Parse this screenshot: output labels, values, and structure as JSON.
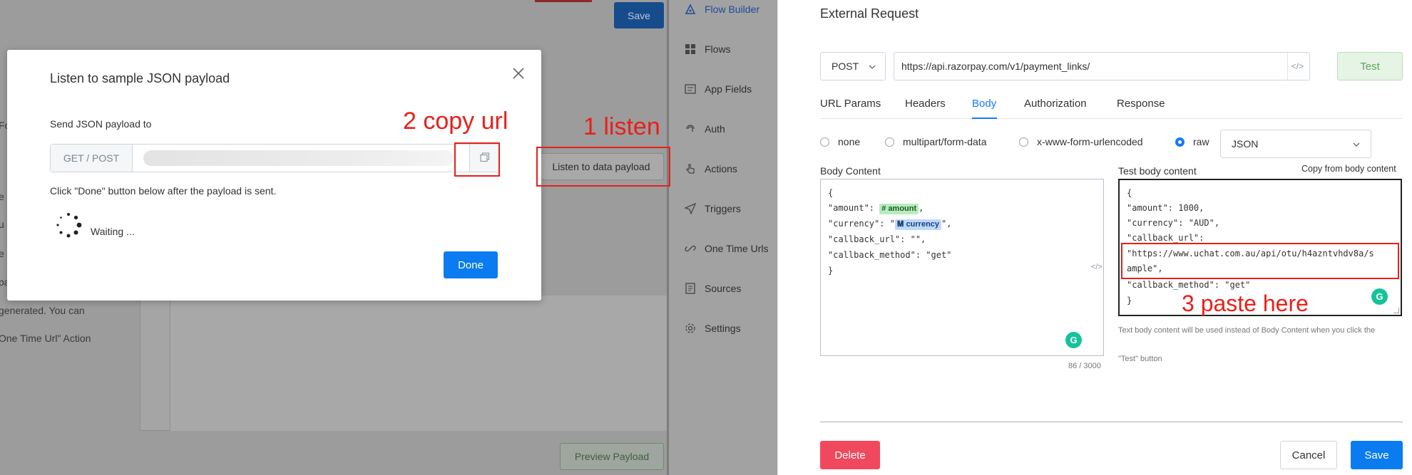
{
  "background": {
    "side_fragments": [
      "Fo",
      "e",
      "u",
      "e",
      "pa",
      "generated. You can",
      "One Time Url\" Action"
    ],
    "save_label": "Save",
    "listen_button_label": "Listen to data payload",
    "preview_button_label": "Preview Payload"
  },
  "sidebar": {
    "items": [
      {
        "label": "Flow Builder",
        "icon": "flow-builder-icon",
        "active": true
      },
      {
        "label": "Flows",
        "icon": "grid-icon"
      },
      {
        "label": "App Fields",
        "icon": "app-fields-icon"
      },
      {
        "label": "Auth",
        "icon": "auth-icon"
      },
      {
        "label": "Actions",
        "icon": "hand-pointer-icon"
      },
      {
        "label": "Triggers",
        "icon": "send-icon"
      },
      {
        "label": "One Time Urls",
        "icon": "link-icon"
      },
      {
        "label": "Sources",
        "icon": "document-icon"
      },
      {
        "label": "Settings",
        "icon": "gear-icon"
      }
    ]
  },
  "modal": {
    "title": "Listen to sample JSON payload",
    "send_label": "Send JSON payload to",
    "method_addon": "GET / POST",
    "hint": "Click \"Done\" button below after the payload is sent.",
    "waiting": "Waiting ...",
    "done_label": "Done"
  },
  "annotations": {
    "step1": "1 listen",
    "step2": "2 copy url",
    "step3": "3 paste here",
    "color": "#e8201a"
  },
  "request": {
    "title": "External Request",
    "method": "POST",
    "url": "https://api.razorpay.com/v1/payment_links/",
    "test_label": "Test",
    "tabs": [
      {
        "label": "URL Params"
      },
      {
        "label": "Headers"
      },
      {
        "label": "Body",
        "active": true
      },
      {
        "label": "Authorization"
      },
      {
        "label": "Response"
      }
    ],
    "body_types": [
      {
        "label": "none"
      },
      {
        "label": "multipart/form-data"
      },
      {
        "label": "x-www-form-urlencoded"
      },
      {
        "label": "raw",
        "checked": true
      }
    ],
    "format": "JSON",
    "body_content_label": "Body Content",
    "body": {
      "open": "{",
      "amount_key": "\"amount\": ",
      "amount_var": "amount",
      "currency_key": "\"currency\": \"",
      "currency_var": "currency",
      "currency_tail": "\",",
      "callback_url": "\"callback_url\": \"\",",
      "callback_method": "\"callback_method\": \"get\"",
      "close": "}"
    },
    "counter": "86 / 3000",
    "test_body_label": "Test body content",
    "copy_from_label": "Copy from body content",
    "test_body": [
      "{",
      "\"amount\": 1000,",
      "\"currency\": \"AUD\",",
      "\"callback_url\":",
      "\"https://www.uchat.com.au/api/otu/h4azntvhdv8a/s",
      "ample\",",
      "\"callback_method\": \"get\"",
      "}"
    ],
    "note_line1": "Text body content will be used instead of Body Content when you click the",
    "note_line2": "\"Test\" button",
    "delete_label": "Delete",
    "cancel_label": "Cancel",
    "save_label": "Save",
    "accent": "#0a7cf0",
    "danger": "#f0495d"
  }
}
